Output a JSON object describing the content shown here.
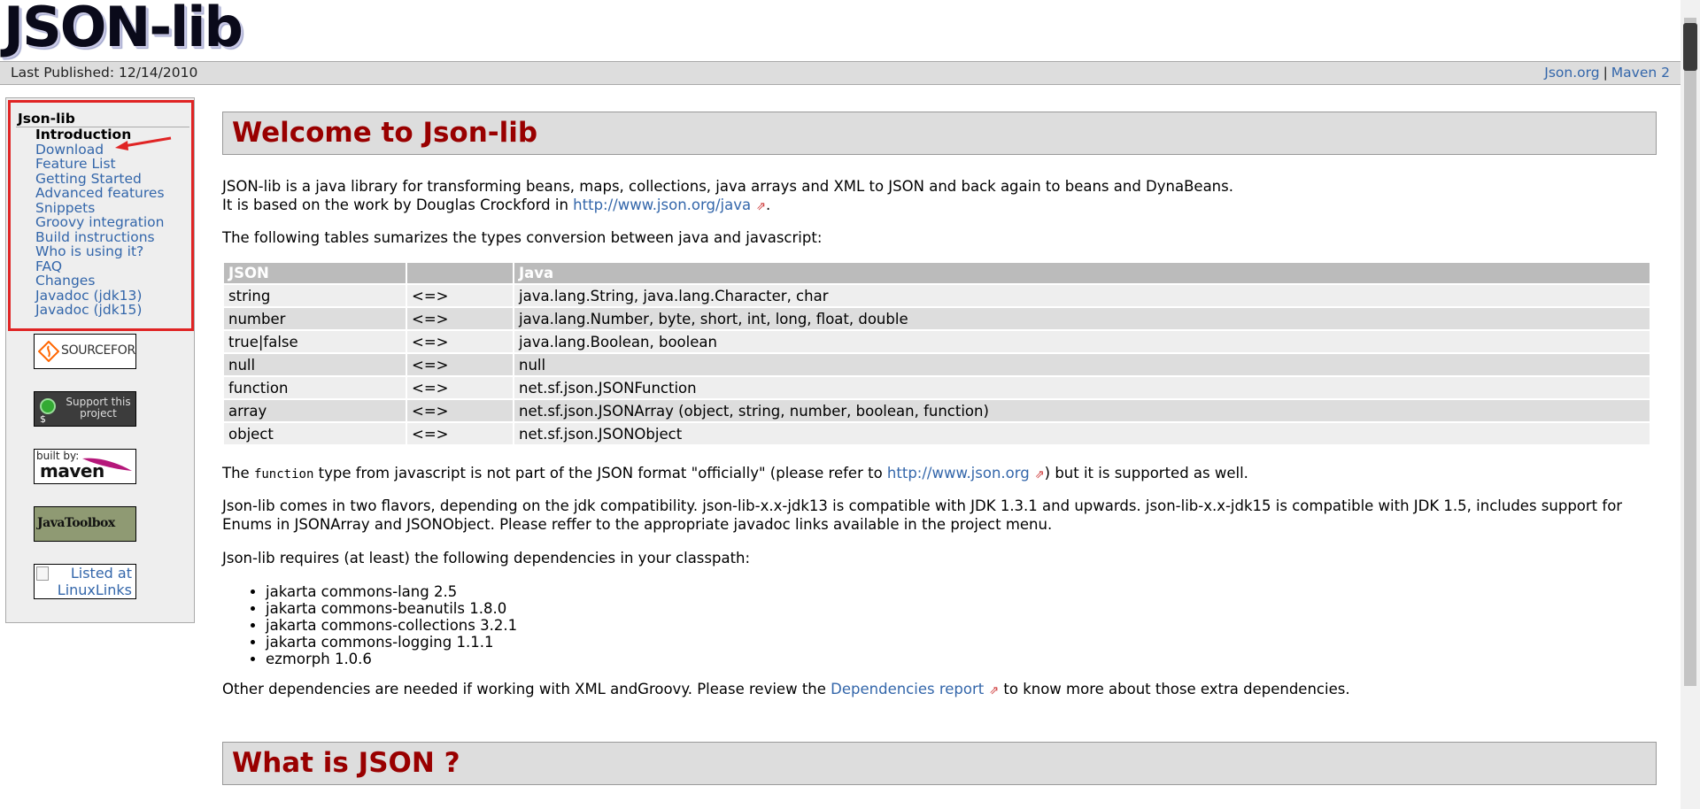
{
  "header": {
    "logo_text": "JSON-lib",
    "last_published": "Last Published: 12/14/2010",
    "links": [
      {
        "label": "Json.org"
      },
      {
        "label": "Maven 2"
      }
    ],
    "separator": "|"
  },
  "nav": {
    "heading": "Json-lib",
    "items": [
      {
        "label": "Introduction",
        "current": true
      },
      {
        "label": "Download"
      },
      {
        "label": "Feature List"
      },
      {
        "label": "Getting Started"
      },
      {
        "label": "Advanced features"
      },
      {
        "label": "Snippets"
      },
      {
        "label": "Groovy integration"
      },
      {
        "label": "Build instructions"
      },
      {
        "label": "Who is using it?"
      },
      {
        "label": "FAQ"
      },
      {
        "label": "Changes"
      },
      {
        "label": "Javadoc (jdk13)"
      },
      {
        "label": "Javadoc (jdk15)"
      }
    ]
  },
  "badges": {
    "sourceforge": "SOURCEFORGE",
    "support": "Support this project",
    "maven_built_by": "built by:",
    "maven": "maven",
    "javatoolbox": "JavaToolbox",
    "linuxlinks": "Listed at LinuxLinks"
  },
  "main": {
    "welcome_title": "Welcome to Json-lib",
    "intro_line1": "JSON-lib is a java library for transforming beans, maps, collections, java arrays and XML to JSON and back again to beans and DynaBeans.",
    "intro_line2_prefix": "It is based on the work by Douglas Crockford in ",
    "intro_line2_link": "http://www.json.org/java",
    "intro_line2_suffix": ".",
    "tables_intro": "The following tables sumarizes the types conversion between java and javascript:",
    "table": {
      "headers": [
        "JSON",
        "",
        "Java"
      ],
      "rows": [
        [
          "string",
          "<=>",
          "java.lang.String, java.lang.Character, char"
        ],
        [
          "number",
          "<=>",
          "java.lang.Number, byte, short, int, long, float, double"
        ],
        [
          "true|false",
          "<=>",
          "java.lang.Boolean, boolean"
        ],
        [
          "null",
          "<=>",
          "null"
        ],
        [
          "function",
          "<=>",
          "net.sf.json.JSONFunction"
        ],
        [
          "array",
          "<=>",
          "net.sf.json.JSONArray (object, string, number, boolean, function)"
        ],
        [
          "object",
          "<=>",
          "net.sf.json.JSONObject"
        ]
      ]
    },
    "function_note_prefix": "The ",
    "function_note_code": "function",
    "function_note_middle": " type from javascript is not part of the JSON format \"officially\" (please refer to ",
    "function_note_link": "http://www.json.org",
    "function_note_suffix": ") but it is supported as well.",
    "flavors": "Json-lib comes in two flavors, depending on the jdk compatibility. json-lib-x.x-jdk13 is compatible with JDK 1.3.1 and upwards. json-lib-x.x-jdk15 is compatible with JDK 1.5, includes support for Enums in JSONArray and JSONObject. Please reffer to the appropriate javadoc links available in the project menu.",
    "requires": "Json-lib requires (at least) the following dependencies in your classpath:",
    "dependencies": [
      "jakarta commons-lang 2.5",
      "jakarta commons-beanutils 1.8.0",
      "jakarta commons-collections 3.2.1",
      "jakarta commons-logging 1.1.1",
      "ezmorph 1.0.6"
    ],
    "other_prefix": "Other dependencies are needed if working with XML andGroovy. Please review the ",
    "other_link": "Dependencies report",
    "other_suffix": " to know more about those extra dependencies.",
    "what_title": "What is JSON ?"
  }
}
